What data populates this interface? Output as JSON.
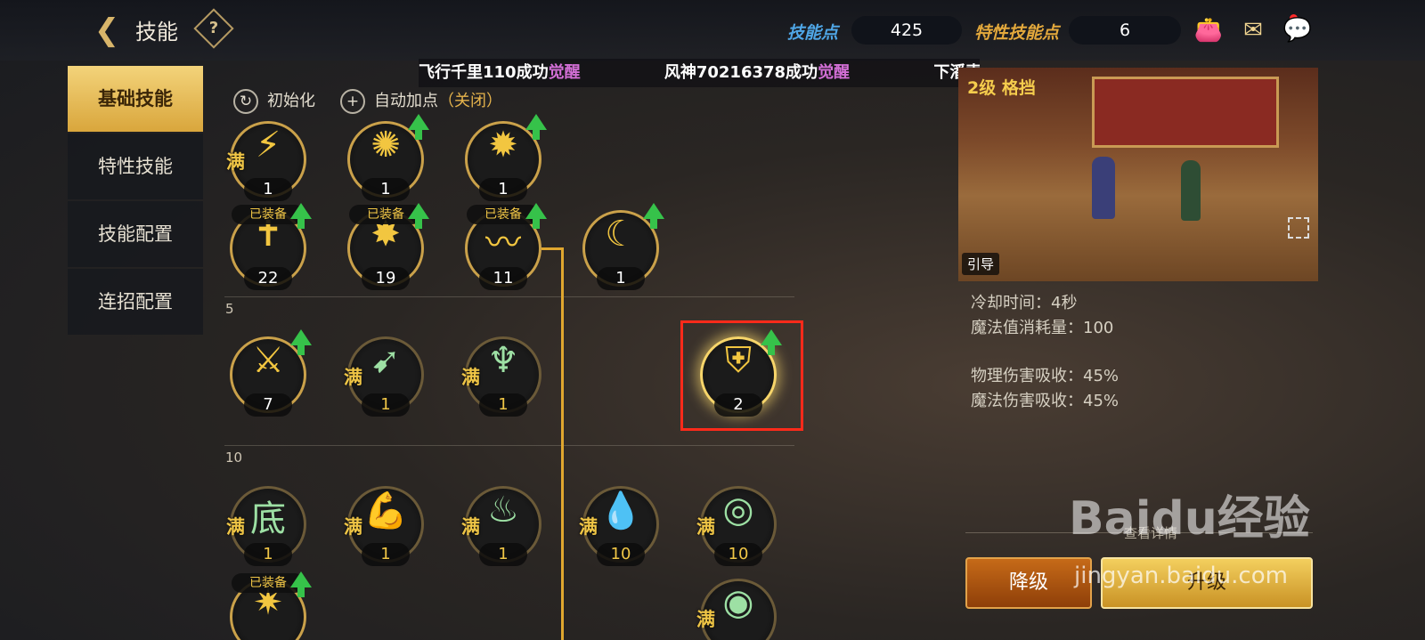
{
  "header": {
    "title": "技能",
    "back_icon": "back-arrow-icon",
    "help_label": "?",
    "skill_points_label": "技能点",
    "skill_points_value": "425",
    "trait_points_label": "特性技能点",
    "trait_points_value": "6",
    "icons": [
      "bag-icon",
      "mail-icon",
      "chat-icon"
    ]
  },
  "sidebar": {
    "items": [
      {
        "label": "基础技能",
        "active": true
      },
      {
        "label": "特性技能",
        "active": false
      },
      {
        "label": "技能配置",
        "active": false
      },
      {
        "label": "连招配置",
        "active": false
      }
    ]
  },
  "ticker": {
    "msg1": "飞行千里110成功",
    "msg2": "风神70216378成功",
    "msg3": "下潘索面成功",
    "awaken": "觉醒"
  },
  "toolbar": {
    "reset_label": "初始化",
    "auto_label": "自动加点",
    "auto_state": "（关闭）"
  },
  "tiers": {
    "t5": "5",
    "t10": "10"
  },
  "skills": {
    "full_mark": "满",
    "equipped_label": "已装备",
    "row1": [
      {
        "level": "1",
        "full": true
      },
      {
        "level": "1",
        "full": false
      },
      {
        "level": "1",
        "full": false
      }
    ],
    "row2": [
      {
        "level": "22"
      },
      {
        "level": "19"
      },
      {
        "level": "11"
      },
      {
        "level": "1"
      }
    ],
    "row3": [
      {
        "level": "7"
      },
      {
        "level": "1"
      },
      {
        "level": "1"
      },
      {
        "level": "2"
      }
    ],
    "row4": [
      {
        "level": "1"
      },
      {
        "level": "1"
      },
      {
        "level": "1"
      },
      {
        "level": "10"
      },
      {
        "level": "10"
      }
    ]
  },
  "detail": {
    "title": "2级 格挡",
    "guide_label": "引导",
    "cooldown": "冷却时间：4秒",
    "mana_cost": "魔法值消耗量：100",
    "phys_absorb": "物理伤害吸收：45%",
    "magic_absorb": "魔法伤害吸收：45%",
    "view_detail": "查看详情",
    "downgrade_label": "降级",
    "upgrade_label": "升级"
  },
  "watermark": {
    "logo": "Baidu经验",
    "url": "jingyan.baidu.com"
  }
}
